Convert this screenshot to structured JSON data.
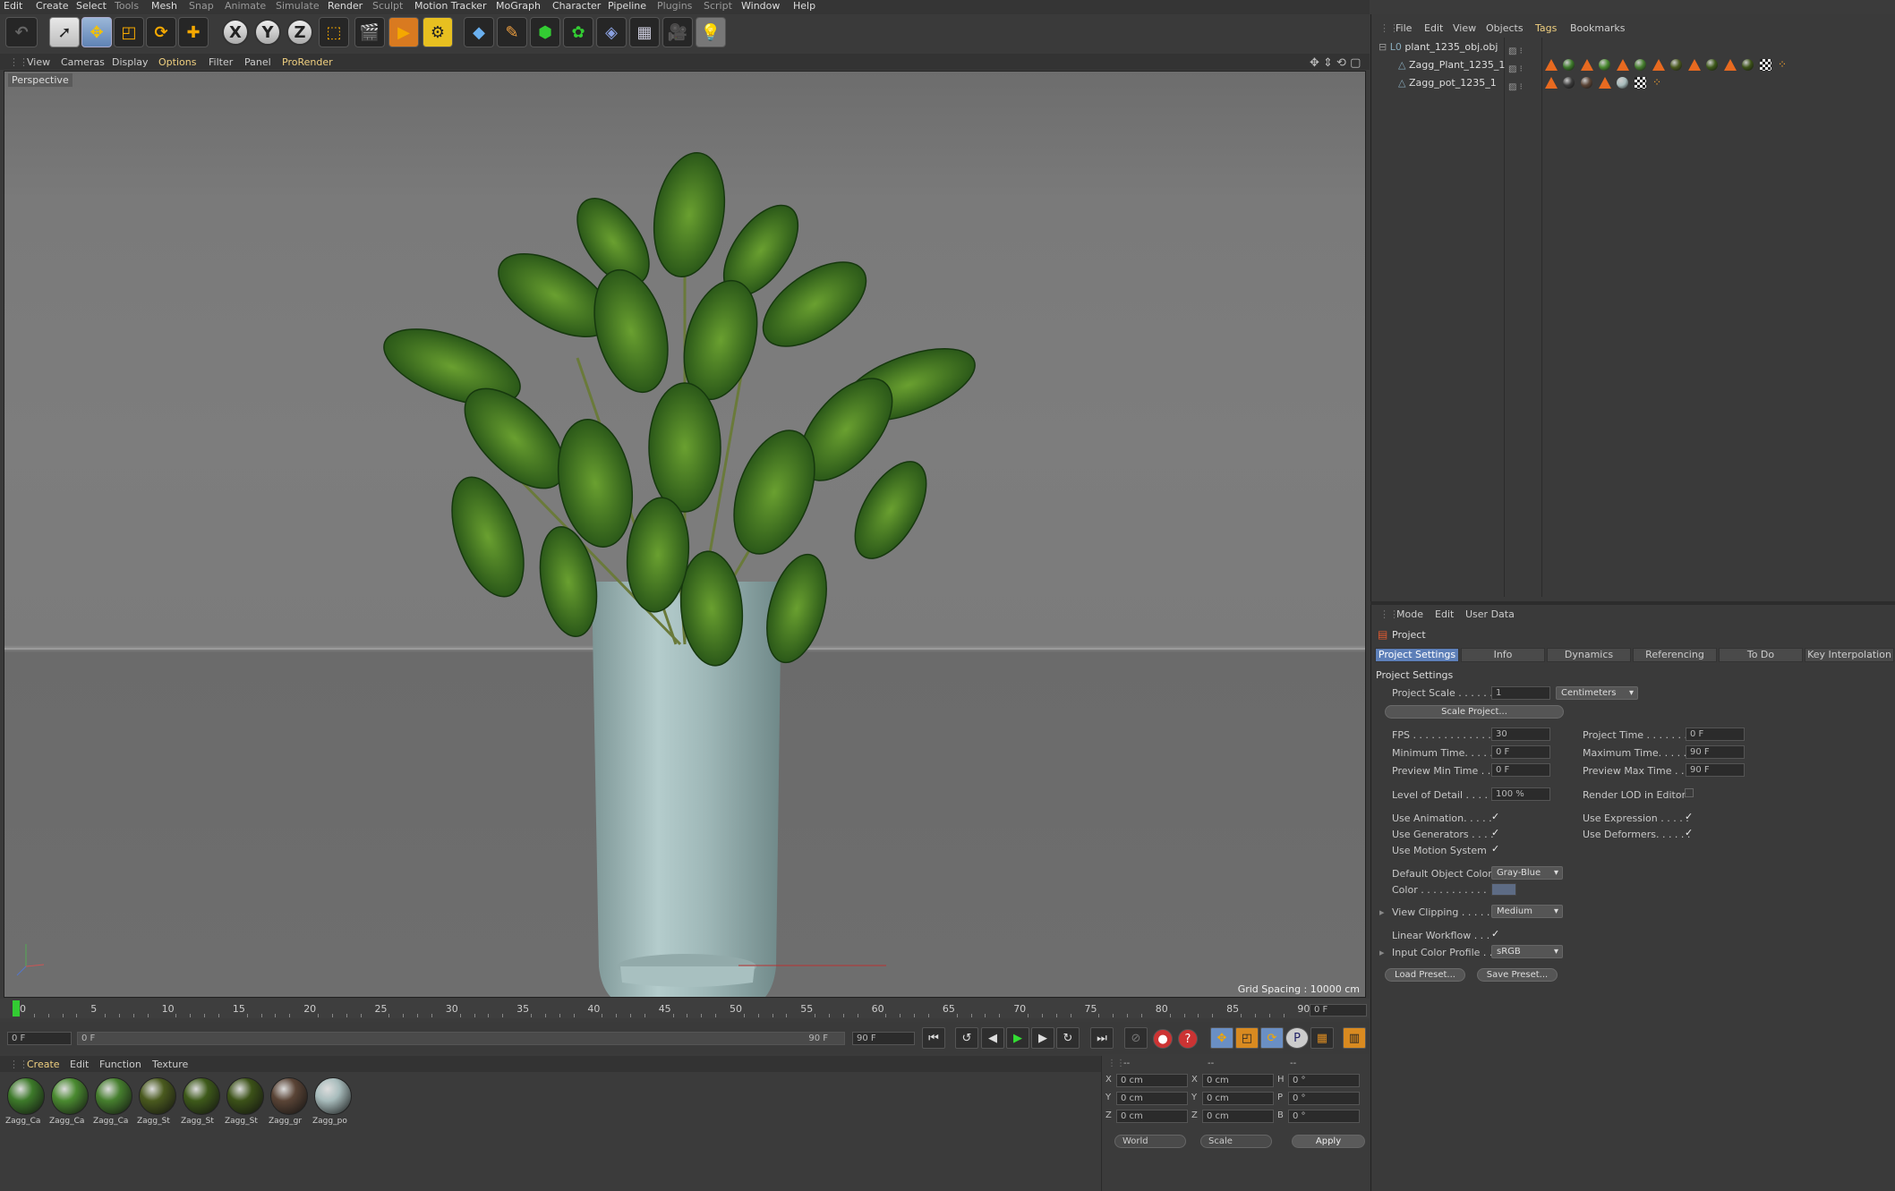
{
  "menubar": [
    "Edit",
    "Create",
    "Select",
    "Tools",
    "Mesh",
    "Snap",
    "Animate",
    "Simulate",
    "Render",
    "Sculpt",
    "Motion Tracker",
    "MoGraph",
    "Character",
    "Pipeline",
    "Plugins",
    "Script",
    "Window",
    "Help"
  ],
  "toolbar": {
    "axis_x": "X",
    "axis_y": "Y",
    "axis_z": "Z"
  },
  "viewport_menu": [
    "View",
    "Cameras",
    "Display",
    "Options",
    "Filter",
    "Panel",
    "ProRender"
  ],
  "viewport": {
    "label": "Perspective",
    "grid_spacing": "Grid Spacing : 10000 cm"
  },
  "timeline": {
    "ticks": [
      "0",
      "5",
      "10",
      "15",
      "20",
      "25",
      "30",
      "35",
      "40",
      "45",
      "50",
      "55",
      "60",
      "65",
      "70",
      "75",
      "80",
      "85",
      "90"
    ],
    "current_frame": "0 F"
  },
  "transport": {
    "start_field": "0 F",
    "range_start": "0 F",
    "range_end": "90 F",
    "end_field": "90 F"
  },
  "material_menu": [
    "Create",
    "Edit",
    "Function",
    "Texture"
  ],
  "materials": [
    {
      "name": "Zagg_Ca",
      "color": "#3d7a2a"
    },
    {
      "name": "Zagg_Ca",
      "color": "#4a8a30"
    },
    {
      "name": "Zagg_Ca",
      "color": "#467f2e"
    },
    {
      "name": "Zagg_St",
      "color": "#4a5a1e"
    },
    {
      "name": "Zagg_St",
      "color": "#3e5a1a"
    },
    {
      "name": "Zagg_St",
      "color": "#3c5218"
    },
    {
      "name": "Zagg_gr",
      "color": "#5a4436"
    },
    {
      "name": "Zagg_po",
      "color": "#a8bcbc"
    }
  ],
  "coords": {
    "header": [
      "--",
      "--",
      "--"
    ],
    "rows": [
      {
        "a": "X",
        "av": "0 cm",
        "b": "X",
        "bv": "0 cm",
        "c": "H",
        "cv": "0 °"
      },
      {
        "a": "Y",
        "av": "0 cm",
        "b": "Y",
        "bv": "0 cm",
        "c": "P",
        "cv": "0 °"
      },
      {
        "a": "Z",
        "av": "0 cm",
        "b": "Z",
        "bv": "0 cm",
        "c": "B",
        "cv": "0 °"
      }
    ],
    "world": "World",
    "scale": "Scale",
    "apply": "Apply"
  },
  "object_manager": {
    "menu": [
      "File",
      "Edit",
      "View",
      "Objects",
      "Tags",
      "Bookmarks"
    ],
    "objects": [
      "plant_1235_obj.obj",
      "Zagg_Plant_1235_1",
      "Zagg_pot_1235_1"
    ]
  },
  "attribute_manager": {
    "menu": [
      "Mode",
      "Edit",
      "User Data"
    ],
    "title": "Project",
    "tabs": [
      "Project Settings",
      "Info",
      "Dynamics",
      "Referencing",
      "To Do",
      "Key Interpolation"
    ],
    "section": "Project Settings",
    "project_scale_label": "Project Scale . . . . . .",
    "project_scale": "1",
    "scale_unit": "Centimeters",
    "scale_project_btn": "Scale Project...",
    "fps_label": "FPS . . . . . . . . . . . . . . .",
    "fps": "30",
    "min_time_label": "Minimum Time. . . . .",
    "min_time": "0 F",
    "prev_min_label": "Preview Min Time . .",
    "prev_min": "0 F",
    "proj_time_label": "Project Time . . . . . . . .",
    "proj_time": "0 F",
    "max_time_label": "Maximum Time. . . . . .",
    "max_time": "90 F",
    "prev_max_label": "Preview Max Time . . .",
    "prev_max": "90 F",
    "lod_label": "Level of Detail . . . . .",
    "lod": "100 %",
    "render_lod_label": "Render LOD in Editor",
    "use_anim": "Use Animation. . . . .",
    "use_gen": "Use Generators . . . .",
    "use_motion": "Use Motion System",
    "use_expr": "Use Expression . . . . .",
    "use_deform": "Use Deformers. . . . . .",
    "def_color_label": "Default Object Color",
    "def_color": "Gray-Blue",
    "color_label": "Color . . . . . . . . . . .",
    "view_clip_label": "View Clipping . . . . . .",
    "view_clip": "Medium",
    "linear_label": "Linear Workflow . . .",
    "input_profile_label": "Input Color Profile . .",
    "input_profile": "sRGB",
    "load_preset": "Load Preset...",
    "save_preset": "Save Preset..."
  }
}
